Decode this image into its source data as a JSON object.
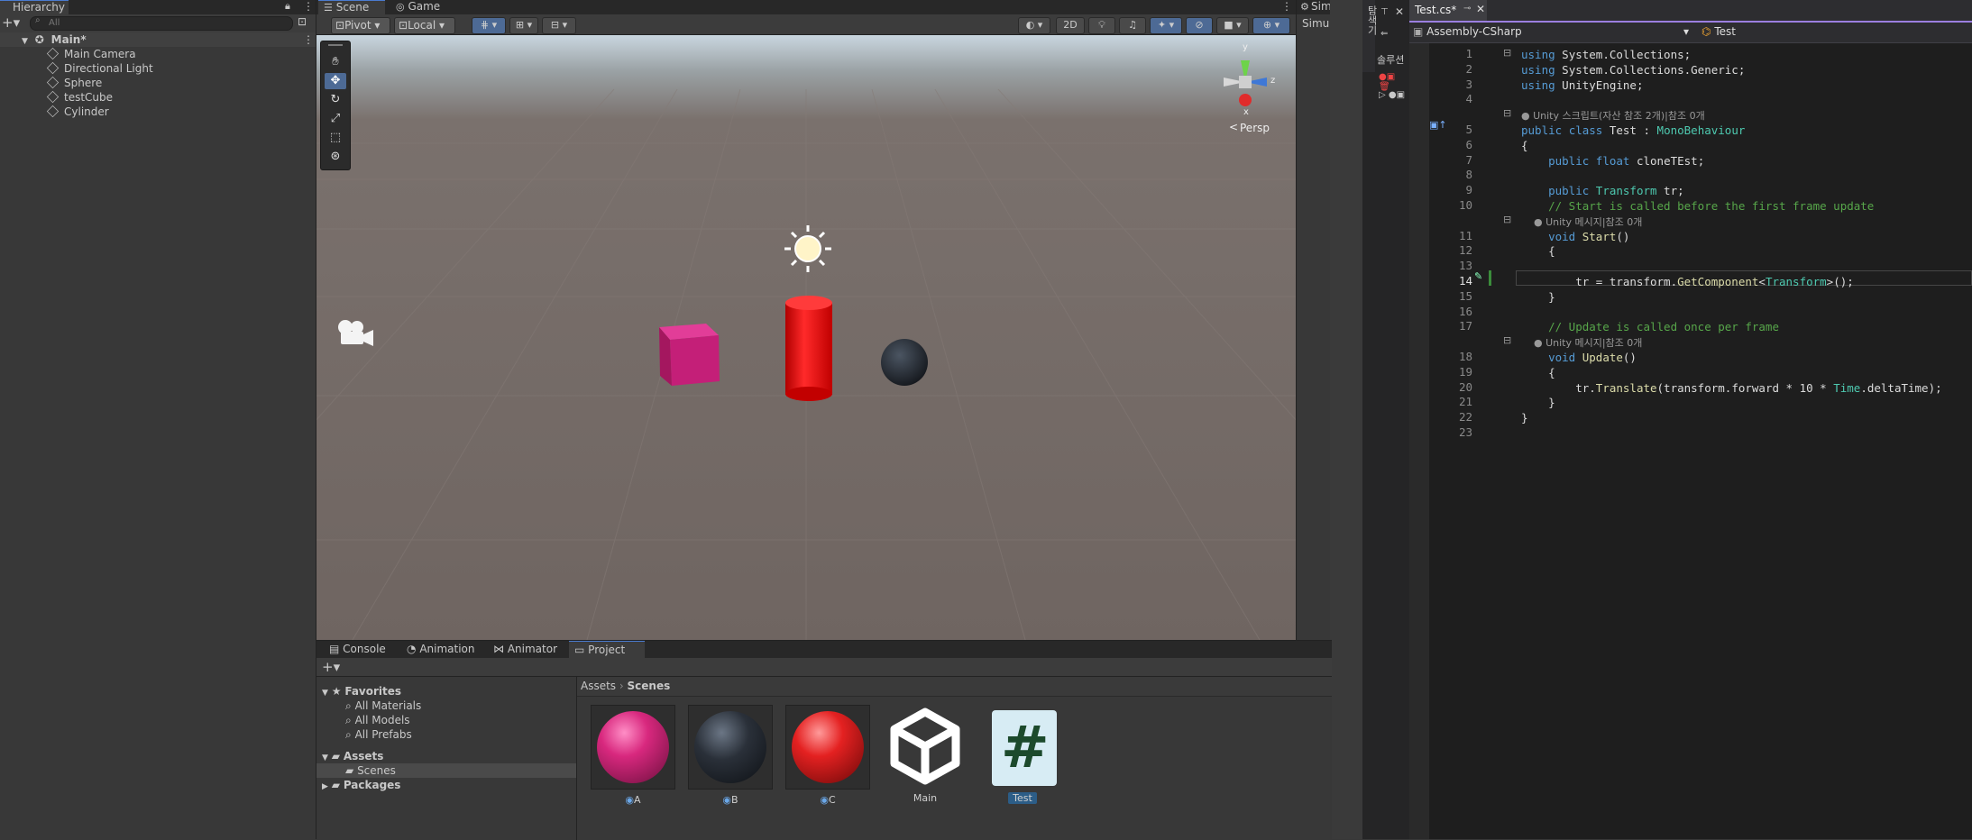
{
  "hierarchy": {
    "tab": "Hierarchy",
    "search_placeholder": "All",
    "scene": "Main*",
    "items": [
      "Main Camera",
      "Directional Light",
      "Sphere",
      "testCube",
      "Cylinder"
    ]
  },
  "scene_view": {
    "tabs": [
      "Scene",
      "Game"
    ],
    "pivot": "Pivot",
    "local": "Local",
    "btn_2d": "2D",
    "gizmo_label": "Persp",
    "axes": {
      "y": "y",
      "z": "z",
      "x": "x"
    }
  },
  "right_strip": {
    "tab": "Sim",
    "label": "Simula"
  },
  "bottom": {
    "tabs": [
      "Console",
      "Animation",
      "Animator",
      "Project"
    ],
    "favorites": {
      "title": "Favorites",
      "items": [
        "All Materials",
        "All Models",
        "All Prefabs"
      ]
    },
    "assets": {
      "title": "Assets",
      "items": [
        "Scenes"
      ]
    },
    "packages": "Packages",
    "breadcrumb": [
      "Assets",
      "Scenes"
    ],
    "files": [
      {
        "name": "A",
        "kind": "material",
        "color": "#d8287e"
      },
      {
        "name": "B",
        "kind": "material",
        "color": "#2a3039"
      },
      {
        "name": "C",
        "kind": "material",
        "color": "#e42121"
      },
      {
        "name": "Main",
        "kind": "scene"
      },
      {
        "name": "Test",
        "kind": "script"
      }
    ]
  },
  "solution_strip": {
    "label": "솔루션",
    "vertical": "탐색기"
  },
  "editor": {
    "tab": "Test.cs*",
    "project": "Assembly-CSharp",
    "member": "Test",
    "lines": [
      {
        "n": "1",
        "text": "using System.Collections;"
      },
      {
        "n": "2",
        "text": "using System.Collections.Generic;"
      },
      {
        "n": "3",
        "text": "using UnityEngine;"
      },
      {
        "n": "4",
        "text": ""
      },
      {
        "n": "",
        "text": "Unity 스크립트(자산 참조 2개)|참조 0개"
      },
      {
        "n": "5",
        "text": "public class Test : MonoBehaviour"
      },
      {
        "n": "6",
        "text": "{"
      },
      {
        "n": "7",
        "text": "    public float cloneTEst;"
      },
      {
        "n": "8",
        "text": ""
      },
      {
        "n": "9",
        "text": "    public Transform tr;"
      },
      {
        "n": "10",
        "text": "    // Start is called before the first frame update"
      },
      {
        "n": "",
        "text": "    Unity 메시지|참조 0개"
      },
      {
        "n": "11",
        "text": "    void Start()"
      },
      {
        "n": "12",
        "text": "    {"
      },
      {
        "n": "13",
        "text": ""
      },
      {
        "n": "14",
        "text": "        tr = transform.GetComponent<Transform>();"
      },
      {
        "n": "15",
        "text": "    }"
      },
      {
        "n": "16",
        "text": ""
      },
      {
        "n": "17",
        "text": "    // Update is called once per frame"
      },
      {
        "n": "",
        "text": "    Unity 메시지|참조 0개"
      },
      {
        "n": "18",
        "text": "    void Update()"
      },
      {
        "n": "19",
        "text": "    {"
      },
      {
        "n": "20",
        "text": "        tr.Translate(transform.forward * 10 * Time.deltaTime);"
      },
      {
        "n": "21",
        "text": "    }"
      },
      {
        "n": "22",
        "text": "}"
      },
      {
        "n": "23",
        "text": ""
      }
    ]
  },
  "colors": {
    "accent": "#4a7bd0",
    "selection": "#2c5d87",
    "code_bg": "#1e1e1e"
  }
}
